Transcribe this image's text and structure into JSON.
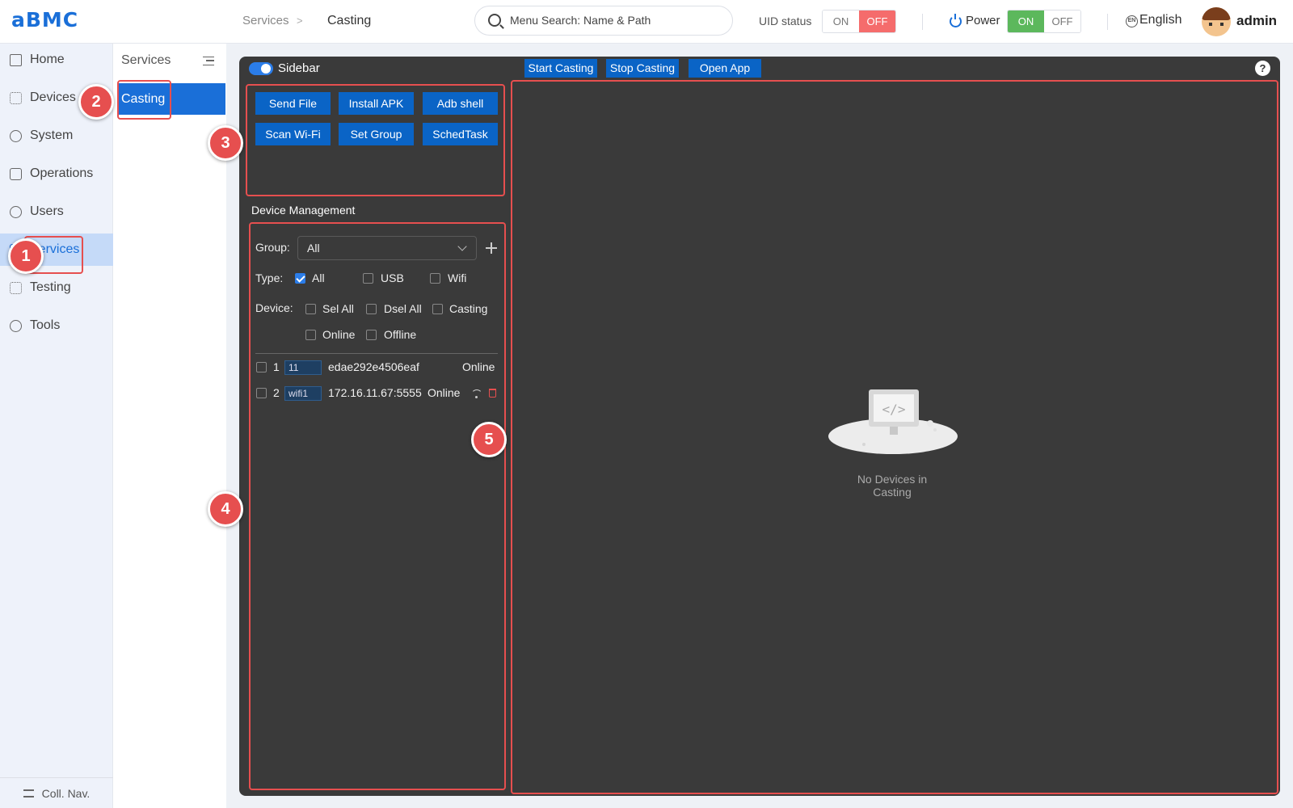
{
  "header": {
    "logo": "aBMC",
    "breadcrumb": [
      "Services",
      "Casting"
    ],
    "breadcrumb_separator": ">",
    "search_placeholder": "Menu Search: Name & Path",
    "uid_status_label": "UID status",
    "uid_toggle": {
      "on": "ON",
      "off": "OFF",
      "selected": "OFF"
    },
    "power_label": "Power",
    "power_toggle": {
      "on": "ON",
      "off": "OFF",
      "selected": "ON"
    },
    "language": "English",
    "language_badge": "EN",
    "user": "admin"
  },
  "left_nav": {
    "items": [
      {
        "label": "Home",
        "icon": "home-icon"
      },
      {
        "label": "Devices",
        "icon": "devices-icon"
      },
      {
        "label": "System",
        "icon": "system-icon"
      },
      {
        "label": "Operations",
        "icon": "operations-icon"
      },
      {
        "label": "Users",
        "icon": "users-icon"
      },
      {
        "label": "Services",
        "icon": "services-icon",
        "active": true
      },
      {
        "label": "Testing",
        "icon": "testing-icon"
      },
      {
        "label": "Tools",
        "icon": "tools-icon"
      }
    ],
    "collapse_label": "Coll. Nav."
  },
  "sub_nav": {
    "title": "Services",
    "items": [
      {
        "label": "Casting",
        "active": true
      }
    ]
  },
  "toolbar": {
    "sidebar_label": "Sidebar",
    "sidebar_on": true,
    "buttons": [
      "Start Casting",
      "Stop Casting",
      "Open App"
    ],
    "help": "?"
  },
  "actions": [
    "Send File",
    "Install APK",
    "Adb shell",
    "Scan Wi-Fi",
    "Set Group",
    "SchedTask"
  ],
  "device_management": {
    "title": "Device Management",
    "group_label": "Group:",
    "group_value": "All",
    "type_label": "Type:",
    "types": [
      {
        "label": "All",
        "checked": true
      },
      {
        "label": "USB",
        "checked": false
      },
      {
        "label": "Wifi",
        "checked": false
      }
    ],
    "device_label": "Device:",
    "device_filters": [
      {
        "label": "Sel All",
        "checked": false
      },
      {
        "label": "Dsel All",
        "checked": false
      },
      {
        "label": "Casting",
        "checked": false
      },
      {
        "label": "Online",
        "checked": false
      },
      {
        "label": "Offline",
        "checked": false
      }
    ],
    "devices": [
      {
        "index": "1",
        "tag": "11",
        "id": "edae292e4506eaf",
        "status": "Online"
      },
      {
        "index": "2",
        "tag": "wifi1",
        "id": "172.16.11.67:5555",
        "status": "Online"
      }
    ]
  },
  "casting_area": {
    "empty_text": "No Devices in Casting"
  },
  "annotations": [
    "1",
    "2",
    "3",
    "4",
    "5"
  ],
  "colors": {
    "accent": "#1a6fd8",
    "button": "#0a64c6",
    "panel_bg": "#3a3a3a",
    "highlight": "#e64f4f",
    "toggle_off": "#f56c6c",
    "toggle_on": "#5cb85c"
  }
}
